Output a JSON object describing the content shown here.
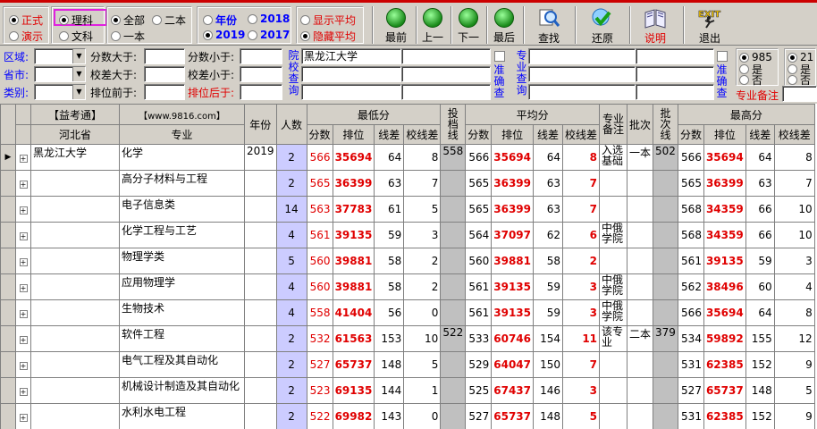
{
  "toolbar": {
    "group1": [
      "正式",
      "演示"
    ],
    "group2": [
      "理科",
      "文科"
    ],
    "group3": [
      "全部",
      "二本",
      "一本"
    ],
    "group4_label": "年份",
    "years": [
      "2018",
      "2019",
      "2017"
    ],
    "group5": [
      "显示平均",
      "隐藏平均"
    ],
    "buttons": [
      "最前",
      "上一",
      "下一",
      "最后",
      "查找",
      "还原",
      "说明",
      "退出"
    ],
    "exit_icon_text": "EXIT"
  },
  "filter": {
    "labels": [
      "区域:",
      "省市:",
      "类别:",
      "分数大于:",
      "校差大于:",
      "排位前于:",
      "分数小于:",
      "校差小于:",
      "排位后于:"
    ],
    "school_vlabel": "院校查询",
    "school_value": "黑龙江大学",
    "major_vlabel": "专业查询",
    "exact_vlabel": "准确查",
    "exact_vlabel2": "准确查",
    "radios985": [
      "985",
      "是",
      "否"
    ],
    "radios211": [
      "21",
      "是",
      "否"
    ],
    "major_note": "专业备注"
  },
  "grid": {
    "headers": {
      "yikaotong": "【益考通】",
      "site": "【www.9816.com】",
      "year": "年份",
      "count": "人数",
      "min": "最低分",
      "toudang": "投档线",
      "avg": "平均分",
      "note": "专业备注",
      "batch": "批次",
      "batchline": "批次线",
      "max": "最高分",
      "province": "河北省",
      "major": "专业",
      "score": "分数",
      "rank": "排位",
      "linediff": "线差",
      "schooldiff": "校线差"
    },
    "rows": [
      {
        "school": "黑龙江大学",
        "major": "化学",
        "year": "2019",
        "count": "2",
        "min": "566",
        "minrank": "35694",
        "minline": "64",
        "minsch": "8",
        "td": "558",
        "avg": "566",
        "avgrank": "35694",
        "avgline": "64",
        "avgsch": "8",
        "note": "入选基础",
        "batch": "一本",
        "bline": "502",
        "max": "566",
        "maxrank": "35694",
        "maxline": "64",
        "maxsch": "8"
      },
      {
        "school": "",
        "major": "高分子材料与工程",
        "year": "",
        "count": "2",
        "min": "565",
        "minrank": "36399",
        "minline": "63",
        "minsch": "7",
        "td": "",
        "avg": "565",
        "avgrank": "36399",
        "avgline": "63",
        "avgsch": "7",
        "note": "",
        "batch": "",
        "bline": "",
        "max": "565",
        "maxrank": "36399",
        "maxline": "63",
        "maxsch": "7"
      },
      {
        "school": "",
        "major": "电子信息类",
        "year": "",
        "count": "14",
        "min": "563",
        "minrank": "37783",
        "minline": "61",
        "minsch": "5",
        "td": "",
        "avg": "565",
        "avgrank": "36399",
        "avgline": "63",
        "avgsch": "7",
        "note": "",
        "batch": "",
        "bline": "",
        "max": "568",
        "maxrank": "34359",
        "maxline": "66",
        "maxsch": "10"
      },
      {
        "school": "",
        "major": "化学工程与工艺",
        "year": "",
        "count": "4",
        "min": "561",
        "minrank": "39135",
        "minline": "59",
        "minsch": "3",
        "td": "",
        "avg": "564",
        "avgrank": "37097",
        "avgline": "62",
        "avgsch": "6",
        "note": "中俄学院",
        "batch": "",
        "bline": "",
        "max": "568",
        "maxrank": "34359",
        "maxline": "66",
        "maxsch": "10"
      },
      {
        "school": "",
        "major": "物理学类",
        "year": "",
        "count": "5",
        "min": "560",
        "minrank": "39881",
        "minline": "58",
        "minsch": "2",
        "td": "",
        "avg": "560",
        "avgrank": "39881",
        "avgline": "58",
        "avgsch": "2",
        "note": "",
        "batch": "",
        "bline": "",
        "max": "561",
        "maxrank": "39135",
        "maxline": "59",
        "maxsch": "3"
      },
      {
        "school": "",
        "major": "应用物理学",
        "year": "",
        "count": "4",
        "min": "560",
        "minrank": "39881",
        "minline": "58",
        "minsch": "2",
        "td": "",
        "avg": "561",
        "avgrank": "39135",
        "avgline": "59",
        "avgsch": "3",
        "note": "中俄学院",
        "batch": "",
        "bline": "",
        "max": "562",
        "maxrank": "38496",
        "maxline": "60",
        "maxsch": "4"
      },
      {
        "school": "",
        "major": "生物技术",
        "year": "",
        "count": "4",
        "min": "558",
        "minrank": "41404",
        "minline": "56",
        "minsch": "0",
        "td": "",
        "avg": "561",
        "avgrank": "39135",
        "avgline": "59",
        "avgsch": "3",
        "note": "中俄学院",
        "batch": "",
        "bline": "",
        "max": "566",
        "maxrank": "35694",
        "maxline": "64",
        "maxsch": "8"
      },
      {
        "school": "",
        "major": "软件工程",
        "year": "",
        "count": "2",
        "min": "532",
        "minrank": "61563",
        "minline": "153",
        "minsch": "10",
        "td": "522",
        "avg": "533",
        "avgrank": "60746",
        "avgline": "154",
        "avgsch": "11",
        "note": "该专业",
        "batch": "二本",
        "bline": "379",
        "max": "534",
        "maxrank": "59892",
        "maxline": "155",
        "maxsch": "12"
      },
      {
        "school": "",
        "major": "电气工程及其自动化",
        "year": "",
        "count": "2",
        "min": "527",
        "minrank": "65737",
        "minline": "148",
        "minsch": "5",
        "td": "",
        "avg": "529",
        "avgrank": "64047",
        "avgline": "150",
        "avgsch": "7",
        "note": "",
        "batch": "",
        "bline": "",
        "max": "531",
        "maxrank": "62385",
        "maxline": "152",
        "maxsch": "9"
      },
      {
        "school": "",
        "major": "机械设计制造及其自动化",
        "year": "",
        "count": "2",
        "min": "523",
        "minrank": "69135",
        "minline": "144",
        "minsch": "1",
        "td": "",
        "avg": "525",
        "avgrank": "67437",
        "avgline": "146",
        "avgsch": "3",
        "note": "",
        "batch": "",
        "bline": "",
        "max": "527",
        "maxrank": "65737",
        "maxline": "148",
        "maxsch": "5"
      },
      {
        "school": "",
        "major": "水利水电工程",
        "year": "",
        "count": "2",
        "min": "522",
        "minrank": "69982",
        "minline": "143",
        "minsch": "0",
        "td": "",
        "avg": "527",
        "avgrank": "65737",
        "avgline": "148",
        "avgsch": "5",
        "note": "",
        "batch": "",
        "bline": "",
        "max": "531",
        "maxrank": "62385",
        "maxline": "152",
        "maxsch": "9"
      }
    ]
  }
}
